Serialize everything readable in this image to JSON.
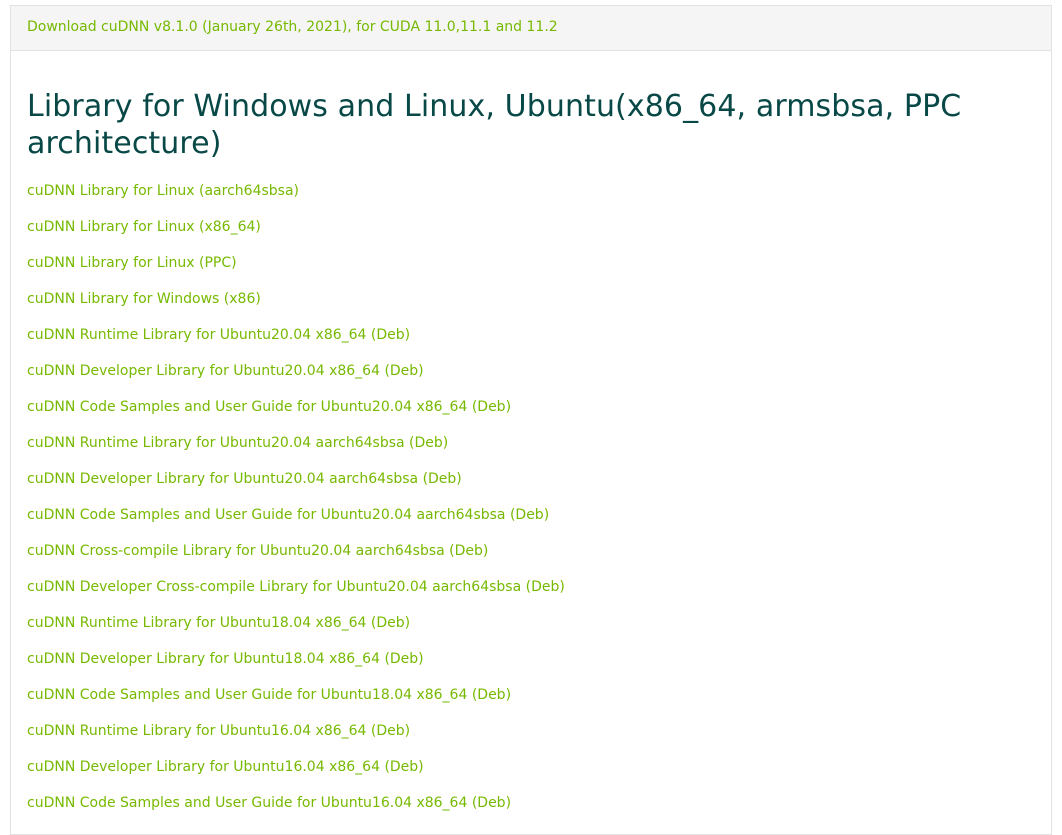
{
  "header": {
    "download_link": "Download cuDNN v8.1.0 (January 26th, 2021), for CUDA 11.0,11.1 and 11.2"
  },
  "section": {
    "title": "Library for Windows and Linux, Ubuntu(x86_64, armsbsa, PPC architecture)"
  },
  "links": [
    "cuDNN Library for Linux (aarch64sbsa)",
    "cuDNN Library for Linux (x86_64)",
    "cuDNN Library for Linux (PPC)",
    "cuDNN Library for Windows (x86)",
    "cuDNN Runtime Library for Ubuntu20.04 x86_64 (Deb)",
    "cuDNN Developer Library for Ubuntu20.04 x86_64 (Deb)",
    "cuDNN Code Samples and User Guide for Ubuntu20.04 x86_64 (Deb)",
    "cuDNN Runtime Library for Ubuntu20.04 aarch64sbsa (Deb)",
    "cuDNN Developer Library for Ubuntu20.04 aarch64sbsa (Deb)",
    "cuDNN Code Samples and User Guide for Ubuntu20.04 aarch64sbsa (Deb)",
    "cuDNN Cross-compile Library for Ubuntu20.04 aarch64sbsa (Deb)",
    "cuDNN Developer Cross-compile Library for Ubuntu20.04 aarch64sbsa (Deb)",
    "cuDNN Runtime Library for Ubuntu18.04 x86_64 (Deb)",
    "cuDNN Developer Library for Ubuntu18.04 x86_64 (Deb)",
    "cuDNN Code Samples and User Guide for Ubuntu18.04 x86_64 (Deb)",
    "cuDNN Runtime Library for Ubuntu16.04 x86_64 (Deb)",
    "cuDNN Developer Library for Ubuntu16.04 x86_64 (Deb)",
    "cuDNN Code Samples and User Guide for Ubuntu16.04 x86_64 (Deb)"
  ],
  "colors": {
    "link": "#76b900",
    "title": "#084846",
    "header_bg": "#f5f5f5",
    "border": "#e2e2e2"
  }
}
